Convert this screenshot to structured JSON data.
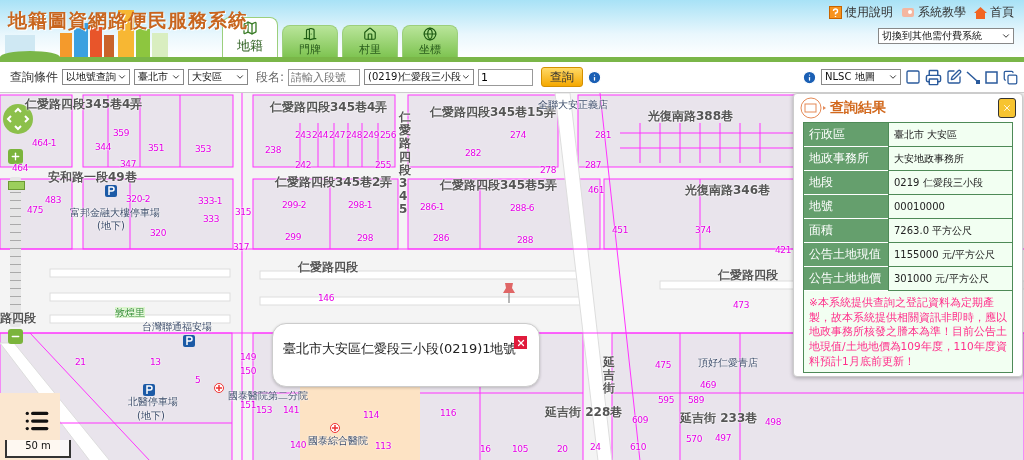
{
  "header": {
    "title": "地籍圖資網路便民服務系統",
    "tabs": [
      {
        "label": "地籍",
        "kind": "parcel",
        "selected": true
      },
      {
        "label": "門牌",
        "kind": "door",
        "selected": false
      },
      {
        "label": "村里",
        "kind": "village",
        "selected": false
      },
      {
        "label": "坐標",
        "kind": "globe",
        "selected": false
      }
    ],
    "links": [
      {
        "label": "使用說明",
        "kind": "help"
      },
      {
        "label": "系統教學",
        "kind": "tutorial"
      },
      {
        "label": "首頁",
        "kind": "home"
      }
    ],
    "system_select": "切換到其他需付費系統"
  },
  "toolbar": {
    "condition_label": "查詢條件",
    "mode": "以地號查詢",
    "city": "臺北市",
    "district": "大安區",
    "section_label": "段名:",
    "section_placeholder": "請輸入段號",
    "section": "(0219)仁愛段三小段",
    "parcel_number": "1",
    "search_button": "查詢",
    "basemap": "NLSC 地圖"
  },
  "map": {
    "zoom": {
      "level": 0.97
    },
    "scale": "50 m",
    "labels": [
      {
        "text": "仁愛路四段345巷4弄",
        "kind": "street"
      },
      {
        "text": "安和路一段49巷",
        "kind": "street"
      },
      {
        "text": "仁愛路四段345巷4弄",
        "kind": "street"
      },
      {
        "text": "仁愛路四段345巷2弄",
        "kind": "street"
      },
      {
        "text": "仁愛路四段345巷15弄",
        "kind": "street"
      },
      {
        "text": "仁愛路四段345巷5弄",
        "kind": "street"
      },
      {
        "text": "仁愛路四段",
        "kind": "street"
      },
      {
        "text": "仁愛路四段",
        "kind": "street"
      },
      {
        "text": "路四段",
        "kind": "street"
      },
      {
        "text": "光復南路388巷",
        "kind": "street"
      },
      {
        "text": "光復南路346巷",
        "kind": "street"
      },
      {
        "text": "延吉街",
        "kind": "vstreet"
      },
      {
        "text": "延吉街 228巷",
        "kind": "street"
      },
      {
        "text": "延吉街 233巷",
        "kind": "street"
      },
      {
        "text": "仁愛路四段345",
        "kind": "vstreet"
      },
      {
        "text": "富邦金融大樓停車場",
        "kind": "poi"
      },
      {
        "text": "(地下)",
        "kind": "poi"
      },
      {
        "text": "台灣聯通福安場",
        "kind": "poi"
      },
      {
        "text": "國泰醫院第二分院",
        "kind": "poi"
      },
      {
        "text": "北醫停車場",
        "kind": "poi"
      },
      {
        "text": "(地下)",
        "kind": "poi"
      },
      {
        "text": "國泰綜合醫院",
        "kind": "poi"
      },
      {
        "text": "頂好仁愛青店",
        "kind": "poi"
      },
      {
        "text": "全聯大安正義店",
        "kind": "poi"
      },
      {
        "text": "敦煌里",
        "kind": "village"
      },
      {
        "text": "464-1",
        "kind": "parcel"
      },
      {
        "text": "359",
        "kind": "parcel"
      },
      {
        "text": "344",
        "kind": "parcel"
      },
      {
        "text": "351",
        "kind": "parcel"
      },
      {
        "text": "353",
        "kind": "parcel"
      },
      {
        "text": "347",
        "kind": "parcel"
      },
      {
        "text": "464",
        "kind": "parcel"
      },
      {
        "text": "483",
        "kind": "parcel"
      },
      {
        "text": "475",
        "kind": "parcel"
      },
      {
        "text": "320-2",
        "kind": "parcel"
      },
      {
        "text": "333-1",
        "kind": "parcel"
      },
      {
        "text": "333",
        "kind": "parcel"
      },
      {
        "text": "320",
        "kind": "parcel"
      },
      {
        "text": "315",
        "kind": "parcel"
      },
      {
        "text": "317",
        "kind": "parcel"
      },
      {
        "text": "238",
        "kind": "parcel"
      },
      {
        "text": "243",
        "kind": "parcel"
      },
      {
        "text": "244",
        "kind": "parcel"
      },
      {
        "text": "247",
        "kind": "parcel"
      },
      {
        "text": "248",
        "kind": "parcel"
      },
      {
        "text": "249",
        "kind": "parcel"
      },
      {
        "text": "256",
        "kind": "parcel"
      },
      {
        "text": "242",
        "kind": "parcel"
      },
      {
        "text": "255",
        "kind": "parcel"
      },
      {
        "text": "299-2",
        "kind": "parcel"
      },
      {
        "text": "298-1",
        "kind": "parcel"
      },
      {
        "text": "299",
        "kind": "parcel"
      },
      {
        "text": "298",
        "kind": "parcel"
      },
      {
        "text": "274",
        "kind": "parcel"
      },
      {
        "text": "282",
        "kind": "parcel"
      },
      {
        "text": "278",
        "kind": "parcel"
      },
      {
        "text": "281",
        "kind": "parcel"
      },
      {
        "text": "286-1",
        "kind": "parcel"
      },
      {
        "text": "288-6",
        "kind": "parcel"
      },
      {
        "text": "286",
        "kind": "parcel"
      },
      {
        "text": "288",
        "kind": "parcel"
      },
      {
        "text": "287",
        "kind": "parcel"
      },
      {
        "text": "461",
        "kind": "parcel"
      },
      {
        "text": "451",
        "kind": "parcel"
      },
      {
        "text": "374",
        "kind": "parcel"
      },
      {
        "text": "421",
        "kind": "parcel"
      },
      {
        "text": "146",
        "kind": "parcel"
      },
      {
        "text": "473",
        "kind": "parcel"
      },
      {
        "text": "149",
        "kind": "parcel"
      },
      {
        "text": "150",
        "kind": "parcel"
      },
      {
        "text": "21",
        "kind": "parcel"
      },
      {
        "text": "13",
        "kind": "parcel"
      },
      {
        "text": "5",
        "kind": "parcel"
      },
      {
        "text": "151",
        "kind": "parcel"
      },
      {
        "text": "153",
        "kind": "parcel"
      },
      {
        "text": "141",
        "kind": "parcel"
      },
      {
        "text": "114",
        "kind": "parcel"
      },
      {
        "text": "140",
        "kind": "parcel"
      },
      {
        "text": "113",
        "kind": "parcel"
      },
      {
        "text": "475",
        "kind": "parcel"
      },
      {
        "text": "469",
        "kind": "parcel"
      },
      {
        "text": "595",
        "kind": "parcel"
      },
      {
        "text": "589",
        "kind": "parcel"
      },
      {
        "text": "116",
        "kind": "parcel"
      },
      {
        "text": "609",
        "kind": "parcel"
      },
      {
        "text": "570",
        "kind": "parcel"
      },
      {
        "text": "16",
        "kind": "parcel"
      },
      {
        "text": "105",
        "kind": "parcel"
      },
      {
        "text": "20",
        "kind": "parcel"
      },
      {
        "text": "24",
        "kind": "parcel"
      },
      {
        "text": "610",
        "kind": "parcel"
      },
      {
        "text": "497",
        "kind": "parcel"
      },
      {
        "text": "498",
        "kind": "parcel"
      }
    ],
    "popup": {
      "text": "臺北市大安區仁愛段三小段(0219)1地號"
    }
  },
  "results": {
    "title": "查詢結果",
    "rows": [
      {
        "label": "行政區",
        "value": "臺北市 大安區"
      },
      {
        "label": "地政事務所",
        "value": "大安地政事務所"
      },
      {
        "label": "地段",
        "value": "0219 仁愛段三小段"
      },
      {
        "label": "地號",
        "value": "00010000"
      },
      {
        "label": "面積",
        "value": "7263.0 平方公尺"
      },
      {
        "label": "公告土地現值",
        "value": "1155000 元/平方公尺"
      },
      {
        "label": "公告土地地價",
        "value": "301000 元/平方公尺"
      }
    ],
    "note": "※本系統提供查詢之登記資料為定期產製，故本系統提供相關資訊非即時，應以地政事務所核發之謄本為準！目前公告土地現值/土地地價為109年度，110年度資料預計1月底前更新！"
  }
}
